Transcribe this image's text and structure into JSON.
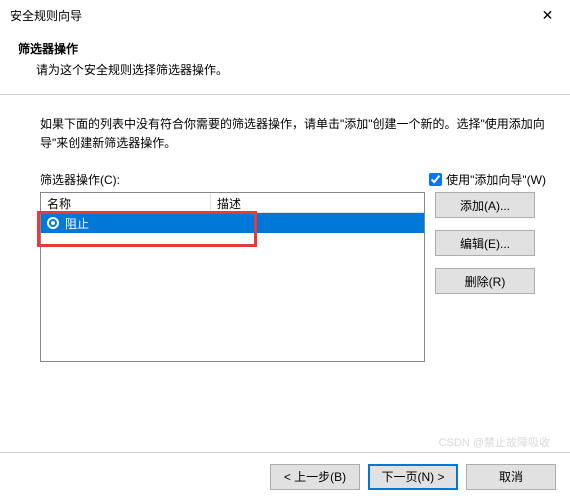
{
  "titlebar": {
    "title": "安全规则向导"
  },
  "header": {
    "title": "筛选器操作",
    "subtitle": "请为这个安全规则选择筛选器操作。"
  },
  "body": {
    "description": "如果下面的列表中没有符合你需要的筛选器操作，请单击\"添加\"创建一个新的。选择\"使用添加向导\"来创建新筛选器操作。",
    "list_label": "筛选器操作(C):",
    "checkbox_label": "使用\"添加向导\"(W)",
    "checkbox_checked": true,
    "columns": {
      "name": "名称",
      "desc": "描述"
    },
    "items": [
      {
        "label": "阻止",
        "selected": true
      }
    ]
  },
  "side_buttons": {
    "add": "添加(A)...",
    "edit": "编辑(E)...",
    "remove": "删除(R)"
  },
  "footer": {
    "back": "< 上一步(B)",
    "next": "下一页(N) >",
    "cancel": "取消"
  },
  "watermark": "CSDN @禁止故障吸收"
}
